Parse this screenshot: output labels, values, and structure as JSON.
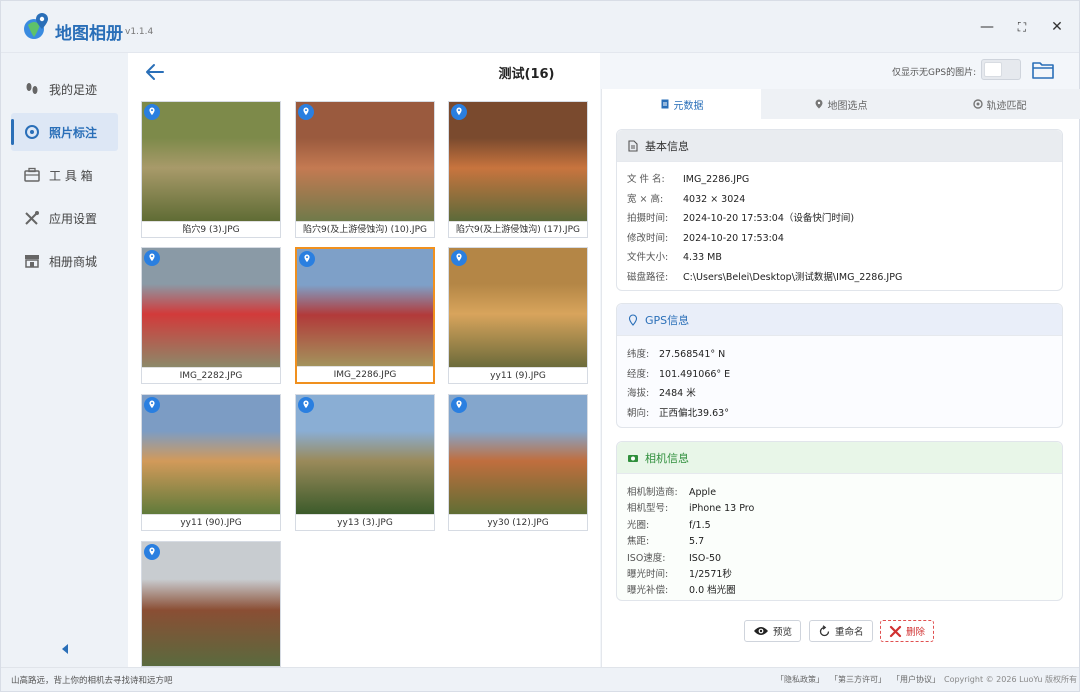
{
  "app": {
    "title": "地图相册",
    "version": "v1.1.4"
  },
  "window_controls": {
    "minimize": "—",
    "maximize": "⛶",
    "close": "✕"
  },
  "sidebar": {
    "items": [
      {
        "label": "我的足迹",
        "icon": "footprints-icon"
      },
      {
        "label": "照片标注",
        "icon": "target-icon",
        "active": true
      },
      {
        "label": "工 具 箱",
        "icon": "toolbox-icon"
      },
      {
        "label": "应用设置",
        "icon": "tools-icon"
      },
      {
        "label": "相册商城",
        "icon": "store-icon"
      }
    ]
  },
  "gallery": {
    "title": "测试(16)",
    "photos": [
      {
        "name": "陷穴9 (3).JPG",
        "palette": [
          "#7d8a4a",
          "#a89a6a",
          "#5e6b34"
        ]
      },
      {
        "name": "陷穴9(及上游侵蚀沟) (10).JPG",
        "palette": [
          "#9a5a3e",
          "#c47a52",
          "#6e7a4a"
        ]
      },
      {
        "name": "陷穴9(及上游侵蚀沟) (17).JPG",
        "palette": [
          "#7a4a2e",
          "#c8743e",
          "#5a6a3a"
        ]
      },
      {
        "name": "IMG_2282.JPG",
        "palette": [
          "#8a9aa6",
          "#d23a3a",
          "#8b8a6a"
        ]
      },
      {
        "name": "IMG_2286.JPG",
        "palette": [
          "#7ea0c8",
          "#b23a3a",
          "#a2985e"
        ],
        "selected": true
      },
      {
        "name": "yy11 (9).JPG",
        "palette": [
          "#b48646",
          "#d8a45c",
          "#6a6a3a"
        ]
      },
      {
        "name": "yy11 (90).JPG",
        "palette": [
          "#7c9cc4",
          "#d29a5a",
          "#5e7a3a"
        ]
      },
      {
        "name": "yy13 (3).JPG",
        "palette": [
          "#8aaed4",
          "#9a8a5a",
          "#3a5a2a"
        ]
      },
      {
        "name": "yy30 (12).JPG",
        "palette": [
          "#84a6cc",
          "#c06e3e",
          "#5e6e34"
        ]
      },
      {
        "name": "",
        "palette": [
          "#c8ccd0",
          "#8a4e34",
          "#5a6a3e"
        ]
      }
    ]
  },
  "toolbar": {
    "gps_only_label": "仅显示无GPS的图片:",
    "gps_only_on": false
  },
  "panel": {
    "tabs": [
      {
        "label": "元数据",
        "active": true
      },
      {
        "label": "地图选点"
      },
      {
        "label": "轨迹匹配"
      }
    ],
    "basic": {
      "title": "基本信息",
      "rows": [
        {
          "k": "文 件 名:",
          "v": "IMG_2286.JPG"
        },
        {
          "k": "宽 × 高:",
          "v": "4032 × 3024"
        },
        {
          "k": "拍摄时间:",
          "v": "2024-10-20 17:53:04（设备快门时间)"
        },
        {
          "k": "修改时间:",
          "v": "2024-10-20 17:53:04"
        },
        {
          "k": "文件大小:",
          "v": "4.33 MB"
        },
        {
          "k": "磁盘路径:",
          "v": "C:\\Users\\Belei\\Desktop\\测试数据\\IMG_2286.JPG"
        }
      ]
    },
    "gps": {
      "title": "GPS信息",
      "rows": [
        {
          "k": "纬度:",
          "v": "27.568541° N"
        },
        {
          "k": "经度:",
          "v": "101.491066° E"
        },
        {
          "k": "海拔:",
          "v": "2484 米"
        },
        {
          "k": "朝向:",
          "v": "正西偏北39.63°"
        }
      ]
    },
    "camera": {
      "title": "相机信息",
      "rows": [
        {
          "k": "相机制造商:",
          "v": "Apple"
        },
        {
          "k": "相机型号:",
          "v": "iPhone 13 Pro"
        },
        {
          "k": "光圈:",
          "v": "f/1.5"
        },
        {
          "k": "焦距:",
          "v": "5.7"
        },
        {
          "k": "ISO速度:",
          "v": "ISO-50"
        },
        {
          "k": "曝光时间:",
          "v": "1/2571秒"
        },
        {
          "k": "曝光补偿:",
          "v": "0.0 档光圈"
        }
      ]
    },
    "actions": {
      "preview": "预览",
      "rename": "重命名",
      "delete": "删除"
    }
  },
  "statusbar": {
    "tip": "山高路远，背上你的相机去寻找诗和远方吧",
    "links": [
      "「隐私政策」",
      "「第三方许可」",
      "「用户协议」"
    ],
    "copyright": "Copyright © 2026 LuoYu 版权所有"
  },
  "colors": {
    "accent": "#2a6fb8",
    "selected_border": "#f0901e",
    "delete": "#d03030"
  }
}
